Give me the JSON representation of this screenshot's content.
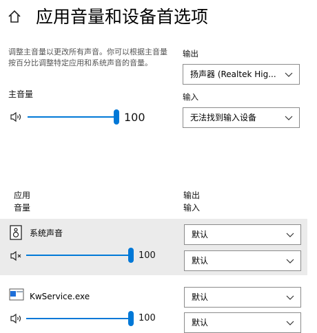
{
  "header": {
    "title": "应用音量和设备首选项"
  },
  "description": "调整主音量以更改所有声音。你可以根据主音量按百分比调整特定应用和系统声音的音量。",
  "master": {
    "label": "主音量",
    "value": "100"
  },
  "output": {
    "label": "输出",
    "selected": "扬声器 (Realtek Hig..."
  },
  "input": {
    "label": "输入",
    "selected": "无法找到输入设备"
  },
  "columns": {
    "app": "应用",
    "volume": "音量",
    "output": "输出",
    "input": "输入"
  },
  "apps": [
    {
      "name": "系统声音",
      "value": "100",
      "output": "默认",
      "input": "默认",
      "muted": true
    },
    {
      "name": "KwService.exe",
      "value": "100",
      "output": "默认",
      "input": "默认",
      "muted": false
    }
  ],
  "colors": {
    "accent": "#0078d7",
    "selected_row": "#ebebeb"
  }
}
